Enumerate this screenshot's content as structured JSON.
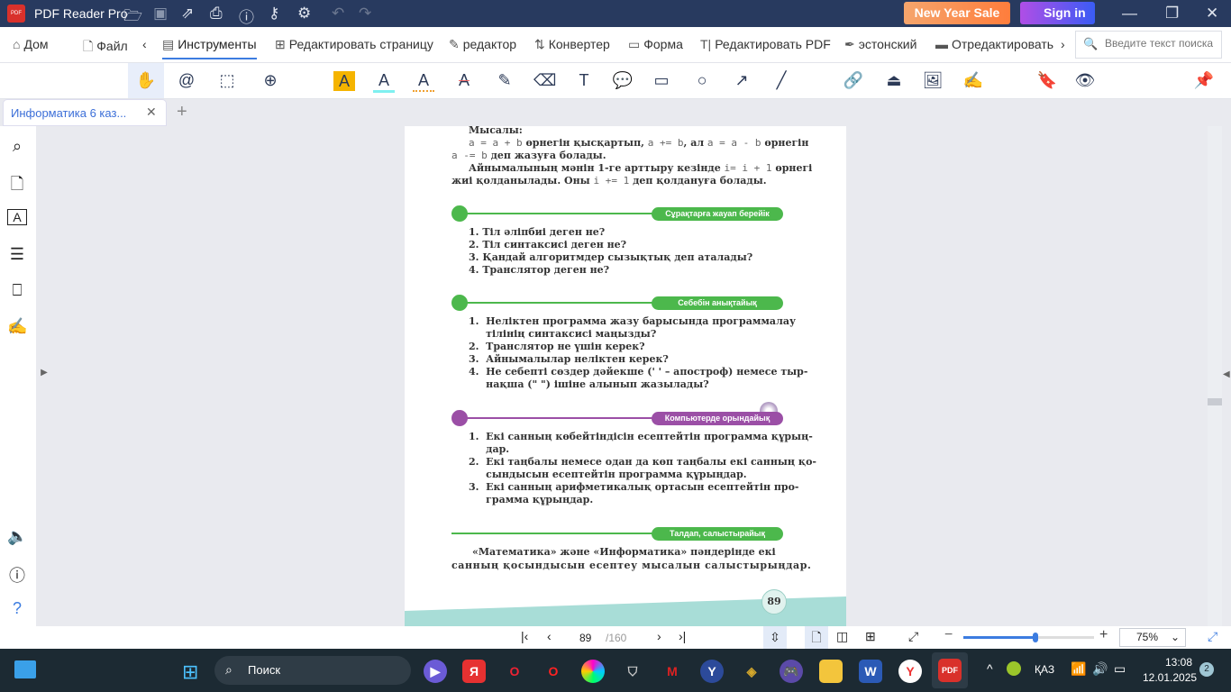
{
  "app": {
    "title": "PDF Reader Pro",
    "sale_label": "New Year Sale",
    "sign_in_label": "Sign in"
  },
  "menu": {
    "items": [
      {
        "label": "Дом"
      },
      {
        "label": "Файл"
      },
      {
        "label": "Инструменты"
      },
      {
        "label": "Редактировать страницу"
      },
      {
        "label": "редактор"
      },
      {
        "label": "Конвертер"
      },
      {
        "label": "Форма"
      },
      {
        "label": "Редактировать PDF"
      },
      {
        "label": "эстонский"
      },
      {
        "label": "Отредактировать"
      }
    ],
    "search_placeholder": "Введите текст поиска"
  },
  "tab": {
    "title": "Информатика 6 каз..."
  },
  "document": {
    "example_heading": "Мысалы:",
    "p1a": "a = a + b",
    "p1b": " өрнегін қысқартып, ",
    "p1c": "a += b",
    "p1d": ", ал ",
    "p1e": "a = a - b",
    "p1f": " өрнегін",
    "p2a": "a -= b",
    "p2b": " деп жазуға болады.",
    "p3a": "Айнымалының мәнін 1-ге арттыру кезінде ",
    "p3b": "i= i + 1",
    "p3c": " өрнегі",
    "p4a": "жиі қолданылады. Оны ",
    "p4b": "i += 1",
    "p4c": " деп қолдануға болады.",
    "sections": [
      {
        "title": "Сұрақтарға жауап берейік",
        "color": "#4cb84c",
        "lines": [
          "1.  Тіл әліпбиі деген не?",
          "2.  Тіл синтаксисі деген не?",
          "3.  Қандай алгоритмдер сызықтық деп аталады?",
          "4.  Транслятор деген не?"
        ]
      },
      {
        "title": "Себебін анықтайық",
        "color": "#4cb84c",
        "lines": [
          "1.  Неліктен программа жазу барысында программалау",
          "     тілінің синтаксисі маңызды?",
          "2.  Транслятор не үшін керек?",
          "3.  Айнымалылар неліктен керек?",
          "4.  Не себепті сөздер дәйекше (' ' – апостроф) немесе тыр-",
          "     нақша (\" \") ішіне алынып жазылады?"
        ]
      },
      {
        "title": "Компьютерде орындайық",
        "color": "#9b4fa6",
        "lines": [
          "1.  Екі санның көбейтіндісін есептейтін программа құрың-",
          "     дар.",
          "2.  Екі таңбалы немесе одан да көп таңбалы екі санның қо-",
          "     сындысын есептейтін программа құрыңдар.",
          "3.  Екі санның арифметикалық ортасын есептейтін про-",
          "     грамма құрыңдар."
        ]
      },
      {
        "title": "Талдап, салыстырайық",
        "color": "#4cb84c",
        "lines": [
          "      «Математика» және «Информатика» пәндерінде екі",
          "санның қосындысын есептеу мысалын салыстырыңдар."
        ]
      }
    ],
    "page_number": "89"
  },
  "status": {
    "current_page": "89",
    "total_pages": "/160",
    "zoom": "75%",
    "zoom_fraction": 0.55
  },
  "taskbar": {
    "search_label": "Поиск",
    "language": "ҚАЗ",
    "time": "13:08",
    "date": "12.01.2025",
    "notifications": "2"
  }
}
